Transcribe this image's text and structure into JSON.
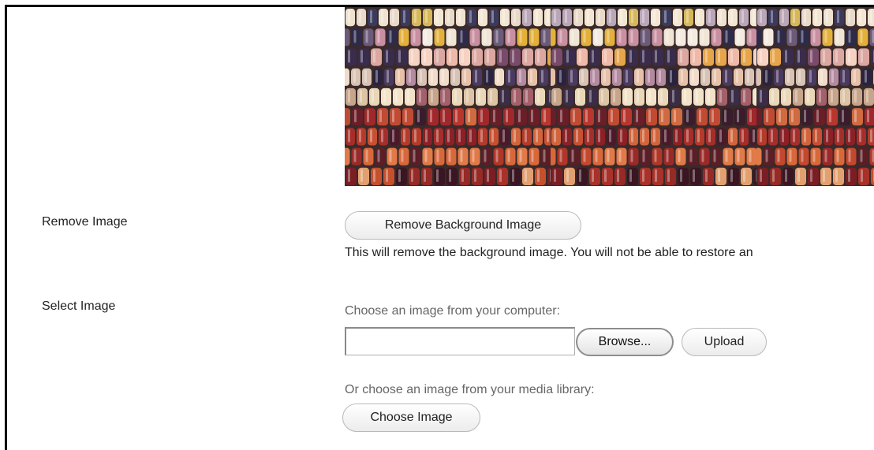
{
  "background_image": {
    "alt": "Indian corn kernels background image preview"
  },
  "remove_section": {
    "label": "Remove Image",
    "button_label": "Remove Background Image",
    "description": "This will remove the background image. You will not be able to restore an"
  },
  "select_section": {
    "label": "Select Image",
    "upload_hint": "Choose an image from your computer:",
    "file_input_value": "",
    "browse_label": "Browse...",
    "upload_label": "Upload",
    "library_hint": "Or choose an image from your media library:",
    "choose_label": "Choose Image"
  }
}
